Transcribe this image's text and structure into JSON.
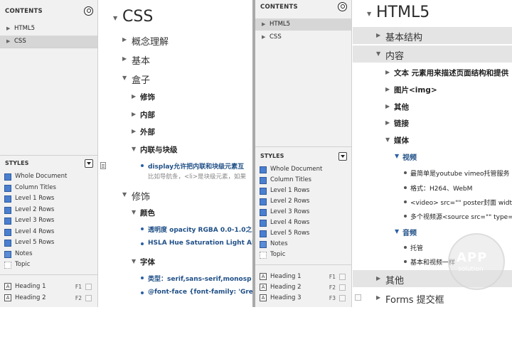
{
  "left": {
    "sidebar": {
      "contents_label": "CONTENTS",
      "items": [
        {
          "label": "HTML5"
        },
        {
          "label": "CSS"
        }
      ],
      "styles_label": "STYLES",
      "styles": [
        {
          "label": "Whole Document"
        },
        {
          "label": "Column Titles"
        },
        {
          "label": "Level 1 Rows"
        },
        {
          "label": "Level 2 Rows"
        },
        {
          "label": "Level 3 Rows"
        },
        {
          "label": "Level 4 Rows"
        },
        {
          "label": "Level 5 Rows"
        },
        {
          "label": "Notes"
        },
        {
          "label": "Topic"
        }
      ],
      "formats": [
        {
          "label": "Heading 1",
          "key": "F1"
        },
        {
          "label": "Heading 2",
          "key": "F2"
        }
      ]
    },
    "editor": {
      "title": "CSS",
      "rows": [
        {
          "text": "概念理解"
        },
        {
          "text": "基本"
        },
        {
          "text": "盒子"
        },
        {
          "text": "修饰"
        },
        {
          "text": "内部"
        },
        {
          "text": "外部"
        },
        {
          "text": "内联与块级"
        },
        {
          "text": "display允许把内联和块级元素互"
        },
        {
          "text": "比如导航条，<li>是块级元素，如果"
        },
        {
          "text": "修饰"
        },
        {
          "text": "颜色"
        },
        {
          "text": "透明度 opacity RGBA 0.0-1.0之"
        },
        {
          "text": "HSLA Hue Saturation Light Alp"
        },
        {
          "text": "字体"
        },
        {
          "text": "类型：serif,sans-serif,monosp"
        },
        {
          "text": "@font-face {font-family: 'Great"
        }
      ]
    }
  },
  "right": {
    "sidebar": {
      "contents_label": "CONTENTS",
      "items": [
        {
          "label": "HTML5"
        },
        {
          "label": "CSS"
        }
      ],
      "styles_label": "STYLES",
      "styles": [
        {
          "label": "Whole Document"
        },
        {
          "label": "Column Titles"
        },
        {
          "label": "Level 1 Rows"
        },
        {
          "label": "Level 2 Rows"
        },
        {
          "label": "Level 3 Rows"
        },
        {
          "label": "Level 4 Rows"
        },
        {
          "label": "Level 5 Rows"
        },
        {
          "label": "Notes"
        },
        {
          "label": "Topic"
        }
      ],
      "formats": [
        {
          "label": "Heading 1",
          "key": "F1"
        },
        {
          "label": "Heading 2",
          "key": "F2"
        },
        {
          "label": "Heading 3",
          "key": "F3"
        }
      ]
    },
    "editor": {
      "title": "HTML5",
      "rows": [
        {
          "text": "基本结构"
        },
        {
          "text": "内容"
        },
        {
          "text": "文本 元素用来描述页面结构和提供"
        },
        {
          "text": "图片<img>"
        },
        {
          "text": "其他"
        },
        {
          "text": "链接"
        },
        {
          "text": "媒体"
        },
        {
          "text": "视频"
        },
        {
          "text": "最简单是youtube vimeo托管服务"
        },
        {
          "text": "格式：H264、WebM"
        },
        {
          "text": "<video> src=\"\" poster封面 width, h"
        },
        {
          "text": "多个视频源<source src=\"\" type=视"
        },
        {
          "text": "音频"
        },
        {
          "text": "托管"
        },
        {
          "text": "基本和视频一样"
        },
        {
          "text": "其他"
        },
        {
          "text": "Forms 提交框"
        }
      ]
    }
  },
  "watermark": {
    "line1": "APP",
    "line2": "solution"
  }
}
